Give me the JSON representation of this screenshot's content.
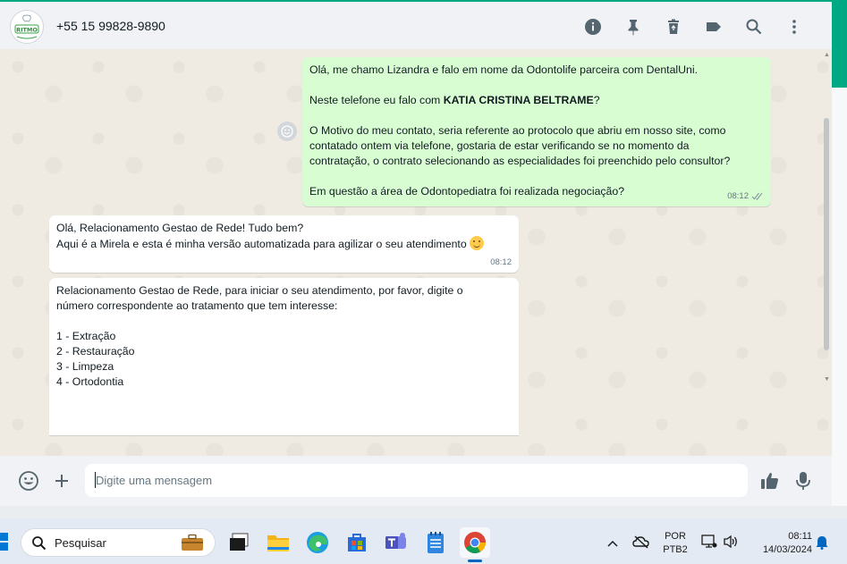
{
  "header": {
    "avatar_text": "RITMO",
    "contact_name": "+55 15 99828-9890",
    "icons": [
      "info-icon",
      "pin-icon",
      "delete-icon",
      "label-icon",
      "search-icon",
      "menu-icon"
    ]
  },
  "messages": {
    "outgoing": {
      "line1": "Olá, me chamo Lizandra e falo em nome da Odontolife parceira com DentalUni.",
      "line2_prefix": "Neste telefone eu falo com ",
      "line2_bold": "KATIA CRISTINA BELTRAME",
      "line2_suffix": "?",
      "line3": "O Motivo do meu contato, seria referente ao protocolo que abriu em nosso site, como\ncontatado ontem via telefone, gostaria de estar verificando se no momento da\ncontratação, o contrato selecionando as especialidades foi preenchido pelo consultor?",
      "line4": "Em questão a área de Odontopediatra foi realizada negociação?",
      "time": "08:12",
      "status_icon": "double-check-icon"
    },
    "incoming1": {
      "line1": "Olá, Relacionamento Gestao de Rede! Tudo bem?",
      "line2": "Aqui é a Mirela e esta é minha versão automatizada para agilizar o seu atendimento",
      "emoji": "hugging-face-emoji",
      "time": "08:12"
    },
    "incoming2": {
      "intro": "Relacionamento Gestao de Rede, para iniciar o seu atendimento, por favor, digite o\nnúmero correspondente ao tratamento que tem interesse:",
      "options": [
        "1 - Extração",
        "2 - Restauração",
        "3 - Limpeza",
        "4 - Ortodontia"
      ]
    }
  },
  "footer": {
    "placeholder": "Digite uma mensagem",
    "icons": [
      "emoji-icon",
      "plus-icon",
      "thumbs-up-icon",
      "microphone-icon"
    ]
  },
  "taskbar": {
    "search_label": "Pesquisar",
    "apps": [
      "briefcase-icon",
      "task-view-icon",
      "file-explorer-icon",
      "edge-icon",
      "store-icon",
      "teams-icon",
      "notepad-icon",
      "chrome-icon"
    ],
    "language_line1": "POR",
    "language_line2": "PTB2",
    "clock_time": "08:11",
    "clock_date": "14/03/2024"
  },
  "colors": {
    "accent": "#00a884",
    "outgoing_bubble": "#d9fdd3",
    "incoming_bubble": "#ffffff",
    "chat_bg": "#efeae2"
  }
}
